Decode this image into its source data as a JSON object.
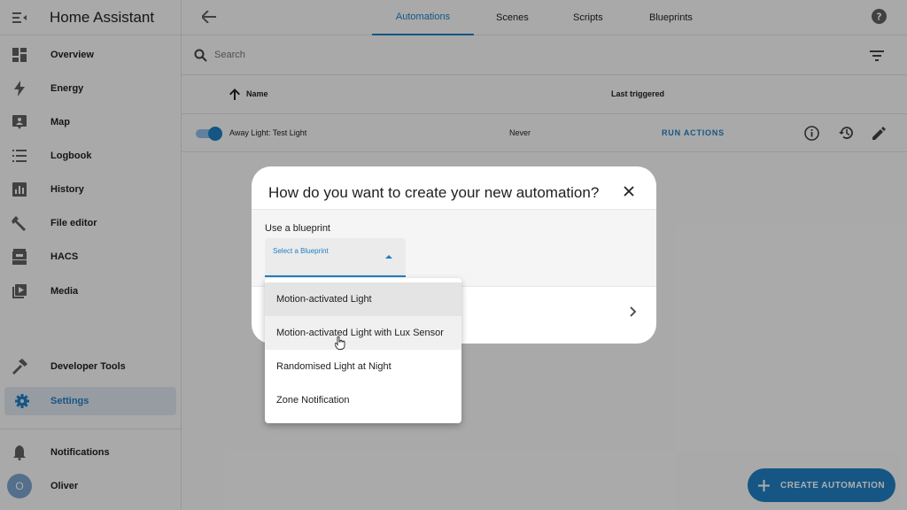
{
  "app": {
    "title": "Home Assistant"
  },
  "sidebar": {
    "items": [
      {
        "label": "Overview",
        "icon": "dashboard-icon"
      },
      {
        "label": "Energy",
        "icon": "lightning-icon"
      },
      {
        "label": "Map",
        "icon": "map-icon"
      },
      {
        "label": "Logbook",
        "icon": "list-icon"
      },
      {
        "label": "History",
        "icon": "chart-icon"
      },
      {
        "label": "File editor",
        "icon": "wrench-icon"
      },
      {
        "label": "HACS",
        "icon": "hacs-icon"
      },
      {
        "label": "Media",
        "icon": "media-icon"
      }
    ],
    "developer_tools": "Developer Tools",
    "settings": "Settings",
    "notifications": "Notifications",
    "user": {
      "name": "Oliver",
      "initial": "O"
    }
  },
  "header": {
    "tabs": [
      "Automations",
      "Scenes",
      "Scripts",
      "Blueprints"
    ],
    "active_tab": "Automations"
  },
  "search": {
    "placeholder": "Search"
  },
  "table": {
    "columns": {
      "name": "Name",
      "last_triggered": "Last triggered"
    },
    "rows": [
      {
        "name": "Away Light: Test Light",
        "last_triggered": "Never",
        "action": "RUN ACTIONS",
        "enabled": true
      }
    ]
  },
  "fab": {
    "label": "CREATE AUTOMATION"
  },
  "dialog": {
    "title": "How do you want to create your new automation?",
    "blueprint_label": "Use a blueprint",
    "select_placeholder": "Select a Blueprint",
    "options": [
      "Motion-activated Light",
      "Motion-activated Light with Lux Sensor",
      "Randomised Light at Night",
      "Zone Notification"
    ],
    "selected_option": "Motion-activated Light",
    "hovered_option": "Motion-activated Light with Lux Sensor"
  },
  "colors": {
    "accent": "#1f7fc4",
    "active_bg": "#dde6ee",
    "avatar": "#7ca4cf"
  }
}
